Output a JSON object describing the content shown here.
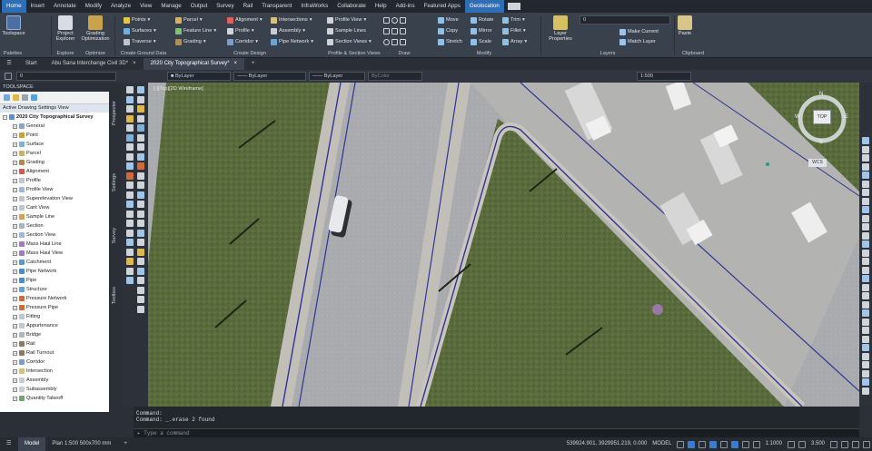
{
  "menu_tabs": [
    "Home",
    "Insert",
    "Annotate",
    "Modify",
    "Analyze",
    "View",
    "Manage",
    "Output",
    "Survey",
    "Rail",
    "Transparent",
    "InfraWorks",
    "Collaborate",
    "Help",
    "Add-ins",
    "Featured Apps",
    "Geolocation"
  ],
  "ribbon": {
    "palettes": {
      "toolspace": "Toolspace",
      "label": "Palettes"
    },
    "explore": {
      "project_explorer": "Project Explorer",
      "label": "Explore"
    },
    "optimize": {
      "grading_optimization": "Grading Optimization",
      "label": "Optimize"
    },
    "ground": {
      "points": "Points",
      "surfaces": "Surfaces",
      "traverse": "Traverse",
      "label": "Create Ground Data"
    },
    "design": {
      "parcel": "Parcel",
      "feature_line": "Feature Line",
      "grading": "Grading",
      "alignment": "Alignment",
      "profile": "Profile",
      "corridor": "Corridor",
      "intersections": "Intersections",
      "assembly": "Assembly",
      "pipe_network": "Pipe Network",
      "label": "Create Design"
    },
    "views": {
      "profile_view": "Profile View",
      "sample_lines": "Sample Lines",
      "section_views": "Section Views",
      "label": "Profile & Section Views"
    },
    "draw": {
      "label": "Draw"
    },
    "modify": {
      "move": "Move",
      "rotate": "Rotate",
      "trim": "Trim",
      "copy": "Copy",
      "mirror": "Mirror",
      "fillet": "Fillet",
      "stretch": "Stretch",
      "scale": "Scale",
      "array": "Array",
      "label": "Modify"
    },
    "layers": {
      "layer_properties": "Layer Properties",
      "layer_value": "0",
      "make_current": "Make Current",
      "match_layer": "Match Layer",
      "label": "Layers"
    },
    "clipboard": {
      "paste": "Paste",
      "label": "Clipboard"
    }
  },
  "doc_tabs": {
    "start": "Start",
    "tab1": "Abu Sana Interchange Civil 3D*",
    "tab2": "2020 City Topographical Survey*"
  },
  "propbar": {
    "layer": "0",
    "color": "ByLayer",
    "linetype": "ByLayer",
    "lineweight": "ByLayer",
    "plotstyle": "ByColor",
    "scale": "1:500"
  },
  "toolspace": {
    "title": "TOOLSPACE",
    "view": "Active Drawing Settings View",
    "root": "2020 City Topographical Survey",
    "items": [
      "General",
      "Point",
      "Surface",
      "Parcel",
      "Grading",
      "Alignment",
      "Profile",
      "Profile View",
      "Superelevation View",
      "Cant View",
      "Sample Line",
      "Section",
      "Section View",
      "Mass Haul Line",
      "Mass Haul View",
      "Catchment",
      "Pipe Network",
      "Pipe",
      "Structure",
      "Pressure Network",
      "Pressure Pipe",
      "Fitting",
      "Appurtenance",
      "Bridge",
      "Rail",
      "Rail Turnout",
      "Corridor",
      "Intersection",
      "Assembly",
      "Subassembly",
      "Quantity Takeoff"
    ],
    "vtabs": [
      "Prospector",
      "Settings",
      "Survey",
      "Toolbox"
    ]
  },
  "viewport_label": "[-][Top][2D Wireframe]",
  "viewcube": {
    "top": "TOP",
    "n": "N",
    "s": "S",
    "e": "E",
    "w": "W",
    "wcs": "WCS"
  },
  "command": {
    "line1": "Command:",
    "line2": "Command:  _.erase 2 found",
    "placeholder": "Type a command"
  },
  "status": {
    "model": "Model",
    "layout": "Plan 1:500  500x700 mm",
    "coords": "539924.901, 3929951.219, 0.000",
    "model_label": "MODEL",
    "scale": "1:1000",
    "lwt": "3.500"
  },
  "colors": {
    "accent": "#2f6db5",
    "ribbon": "#39414d",
    "grass": "#5b6b3a",
    "road": "#a9abb0",
    "pavement": "#c6c3bd",
    "curb": "#3a3f8f"
  }
}
